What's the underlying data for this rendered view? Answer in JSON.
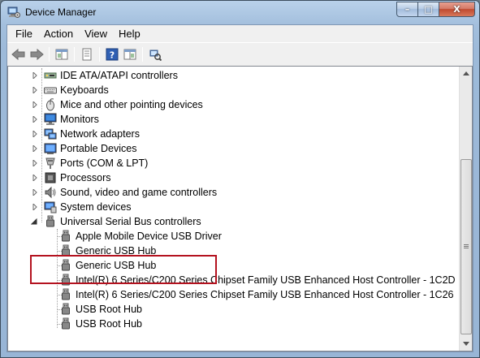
{
  "window": {
    "title": "Device Manager",
    "min_glyph": "–",
    "max_glyph": "□",
    "close_glyph": "X"
  },
  "menu": {
    "items": [
      {
        "label": "File"
      },
      {
        "label": "Action"
      },
      {
        "label": "View"
      },
      {
        "label": "Help"
      }
    ]
  },
  "toolbar": {
    "buttons": [
      {
        "icon": "back-arrow-icon"
      },
      {
        "icon": "forward-arrow-icon"
      },
      {
        "icon": "show-hide-console-tree-icon"
      },
      {
        "icon": "properties-icon"
      },
      {
        "icon": "help-icon"
      },
      {
        "icon": "show-hide-action-pane-icon"
      },
      {
        "icon": "scan-hardware-changes-icon"
      }
    ]
  },
  "tree": {
    "categories": [
      {
        "label": "IDE ATA/ATAPI controllers",
        "icon": "ide-controller-icon",
        "expanded": false
      },
      {
        "label": "Keyboards",
        "icon": "keyboard-icon",
        "expanded": false
      },
      {
        "label": "Mice and other pointing devices",
        "icon": "mouse-icon",
        "expanded": false
      },
      {
        "label": "Monitors",
        "icon": "monitor-icon",
        "expanded": false
      },
      {
        "label": "Network adapters",
        "icon": "network-adapter-icon",
        "expanded": false
      },
      {
        "label": "Portable Devices",
        "icon": "portable-device-icon",
        "expanded": false
      },
      {
        "label": "Ports (COM & LPT)",
        "icon": "port-icon",
        "expanded": false
      },
      {
        "label": "Processors",
        "icon": "processor-icon",
        "expanded": false
      },
      {
        "label": "Sound, video and game controllers",
        "icon": "sound-icon",
        "expanded": false
      },
      {
        "label": "System devices",
        "icon": "system-device-icon",
        "expanded": false
      },
      {
        "label": "Universal Serial Bus controllers",
        "icon": "usb-icon",
        "expanded": true
      }
    ],
    "usb_children": [
      {
        "label": "Apple Mobile Device USB Driver"
      },
      {
        "label": "Generic USB Hub"
      },
      {
        "label": "Generic USB Hub"
      },
      {
        "label": "Intel(R) 6 Series/C200 Series Chipset Family USB Enhanced Host Controller - 1C2D"
      },
      {
        "label": "Intel(R) 6 Series/C200 Series Chipset Family USB Enhanced Host Controller - 1C26"
      },
      {
        "label": "USB Root Hub"
      },
      {
        "label": "USB Root Hub"
      }
    ]
  },
  "colors": {
    "highlight_box": "#b4121f",
    "title_bar": "#b9d1ea",
    "close_button": "#c04a30"
  }
}
